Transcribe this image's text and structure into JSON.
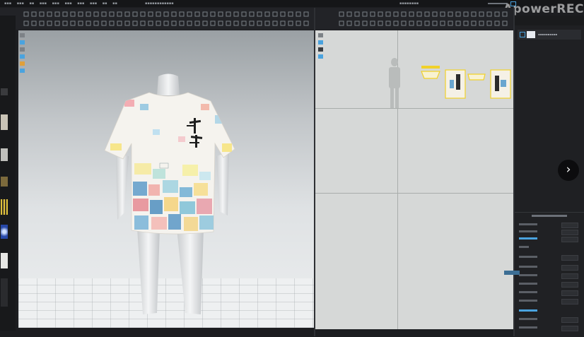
{
  "watermark": "ApowerREC",
  "icons": {
    "next": "chevron-right-icon",
    "check": "checkbox-icon"
  },
  "colors": {
    "accent": "#4aa3df",
    "selection": "#f1d12a",
    "background": "#1c1d20",
    "view2d_bg": "#d6d8d7"
  }
}
